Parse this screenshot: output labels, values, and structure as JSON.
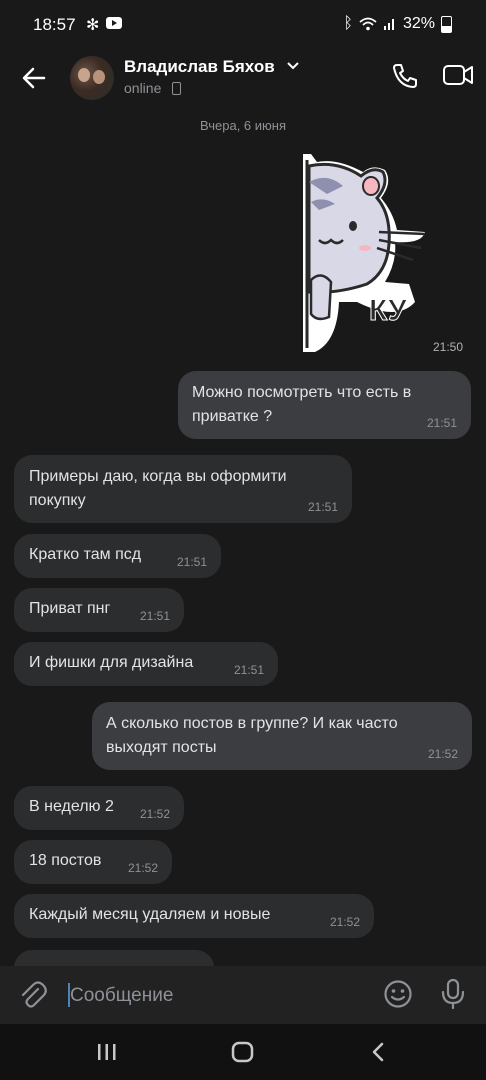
{
  "status": {
    "time": "18:57",
    "battery": "32%"
  },
  "header": {
    "name": "Владислав Бяхов",
    "status": "online"
  },
  "date_divider": "Вчера, 6 июня",
  "sticker": {
    "text": "КУ",
    "time": "21:50"
  },
  "messages": [
    {
      "dir": "out",
      "text": "Можно посмотреть что есть в приватке ?",
      "time": "21:51"
    },
    {
      "dir": "in",
      "text": "Примеры даю, когда вы оформити покупку",
      "time": "21:51"
    },
    {
      "dir": "in",
      "text": "Кратко там псд",
      "time": "21:51"
    },
    {
      "dir": "in",
      "text": "Приват пнг",
      "time": "21:51"
    },
    {
      "dir": "in",
      "text": "И фишки для дизайна",
      "time": "21:51"
    },
    {
      "dir": "out",
      "text": "А сколько постов в группе? И как часто выходят посты",
      "time": "21:52"
    },
    {
      "dir": "in",
      "text": "В неделю 2",
      "time": "21:52"
    },
    {
      "dir": "in",
      "text": "18 постов",
      "time": "21:52"
    },
    {
      "dir": "in",
      "text": "Каждый месяц удаляем и новые",
      "time": "21:52"
    }
  ],
  "composer": {
    "placeholder": "Сообщение"
  },
  "colors": {
    "background": "#191919",
    "incoming_bubble": "#2c2d2e",
    "outgoing_bubble": "#3c3d40",
    "accent": "#5181b8"
  }
}
